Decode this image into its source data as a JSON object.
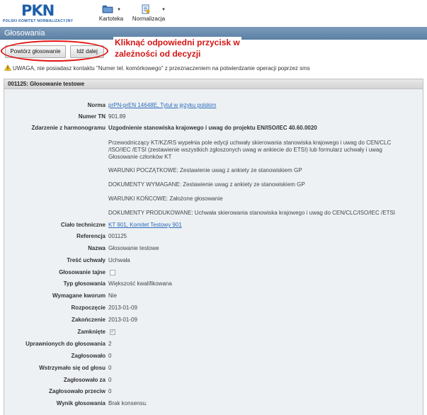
{
  "header": {
    "logo_mark": "PKN",
    "logo_text": "POLSKI KOMITET NORMALIZACYJNY",
    "nav": [
      {
        "label": "Kartoteka",
        "icon": "folder-icon"
      },
      {
        "label": "Normalizacja",
        "icon": "standards-icon"
      }
    ]
  },
  "page": {
    "title": "Głosowania"
  },
  "toolbar": {
    "repeat_label": "Powtórz głosowanie",
    "next_label": "Idź dalej",
    "annotation_line1": "Kliknąć odpowiedni przycisk w",
    "annotation_line2": "zależności od decyzji"
  },
  "warning": {
    "text": "UWAGA, nie posiadasz kontaktu \"Numer tel. komórkowego\" z przeznaczeniem na potwierdzanie operacji poprzez sms"
  },
  "panel": {
    "title": "001125: Głosowanie testowe",
    "fields": {
      "norma": {
        "label": "Norma",
        "value": "prPN-prEN 14648E, Tytuł w języku polskim"
      },
      "numer_tn": {
        "label": "Numer TN",
        "value": "901.89"
      },
      "zdarzenie": {
        "label": "Zdarzenie z harmonogramu",
        "value": "Uzgodnienie stanowiska krajowego i uwag do projektu EN/ISO/IEC 40.60.0020"
      },
      "desc": "Przewodniczący KT/KZ/RS wypełnia pole edycji uchwały skierowania stanowiska krajowego i uwag do CEN/CLC /ISO/IEC /ETSI (zestawienie wszystkich zgłoszonych uwag w ankiecie do ETSI) lub formularz uchwały i uwag Głosowanie członków KT",
      "warunki_pocz": "WARUNKI POCZĄTKOWE: Zestawienie uwag z ankiety ze stanowiskiem GP",
      "dokumenty_wym": "DOKUMENTY WYMAGANE: Zestawienie uwag z ankiety ze stanowiskiem GP",
      "warunki_konc": "WARUNKI KOŃCOWE: Założone głosowanie",
      "dokumenty_prod": "DOKUMENTY PRODUKOWANE: Uchwała skierowania stanowiska krajowego i uwag do CEN/CLC/ISO/IEC /ETSI",
      "cialo": {
        "label": "Ciało techniczne",
        "value": "KT 901, Komitet Testowy 901"
      },
      "referencja": {
        "label": "Referencja",
        "value": "001125"
      },
      "nazwa": {
        "label": "Nazwa",
        "value": "Głosowanie testowe"
      },
      "tresc": {
        "label": "Treść uchwały",
        "value": "Uchwała"
      },
      "tajne": {
        "label": "Głosowanie tajne",
        "checked": false
      },
      "typ": {
        "label": "Typ głosowania",
        "value": "Większość kwalifikowana"
      },
      "kworum": {
        "label": "Wymagane kworum",
        "value": "Nie"
      },
      "rozpoczecie": {
        "label": "Rozpoczęcie",
        "value": "2013-01-09"
      },
      "zakonczenie": {
        "label": "Zakończenie",
        "value": "2013-01-09"
      },
      "zamkniete": {
        "label": "Zamknięte",
        "checked": true
      },
      "uprawnionych": {
        "label": "Uprawnionych do głosowania",
        "value": "2"
      },
      "zaglosowalo": {
        "label": "Zagłosowało",
        "value": "0"
      },
      "wstrzymalo": {
        "label": "Wstrzymało się od głosu",
        "value": "0"
      },
      "za": {
        "label": "Zagłosowało za",
        "value": "0"
      },
      "przeciw": {
        "label": "Zagłosowało przeciw",
        "value": "0"
      },
      "wynik": {
        "label": "Wynik głosowania",
        "value": "Brak konsensu."
      }
    }
  },
  "colors": {
    "title_bar": "#5b7fa3",
    "link": "#2b6cb8",
    "annotation": "#d41414",
    "panel_bg": "#eef1f4"
  }
}
